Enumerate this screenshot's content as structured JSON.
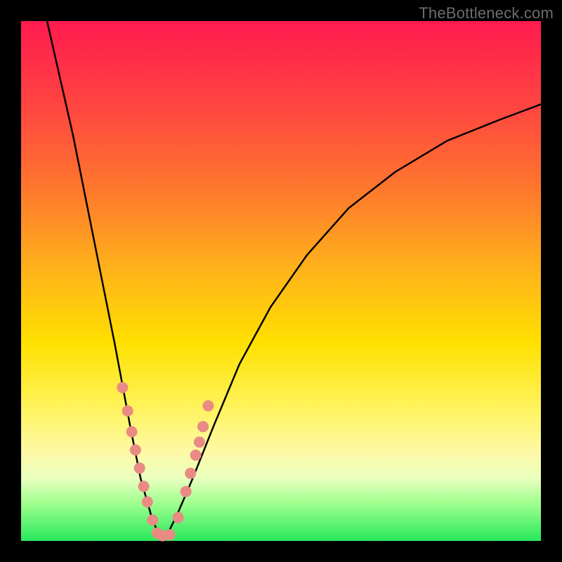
{
  "watermark": "TheBottleneck.com",
  "chart_data": {
    "type": "line",
    "title": "",
    "xlabel": "",
    "ylabel": "",
    "xlim": [
      0,
      100
    ],
    "ylim": [
      0,
      100
    ],
    "grid": false,
    "legend": false,
    "description": "Bottleneck curve on a vertical green-to-red gradient background. Single black V-shaped curve with salmon-colored data points near the minimum. Minimum (~0 bottleneck) occurs around x≈27 on a 0–100 axis.",
    "series": [
      {
        "name": "bottleneck-curve",
        "color": "#000000",
        "x": [
          5,
          10,
          14,
          18,
          21,
          23,
          25,
          26.5,
          28,
          30,
          33,
          37,
          42,
          48,
          55,
          63,
          72,
          82,
          92,
          100
        ],
        "y": [
          100,
          78,
          58,
          38,
          22,
          12,
          5,
          1,
          1,
          5,
          12,
          22,
          34,
          45,
          55,
          64,
          71,
          77,
          81,
          84
        ]
      }
    ],
    "points": {
      "name": "measurements",
      "color": "#e98b84",
      "radius_px": 8,
      "x": [
        19.5,
        20.5,
        21.3,
        22.0,
        22.8,
        23.6,
        24.3,
        25.3,
        26.2,
        27.2,
        28.6,
        30.2,
        31.7,
        32.6,
        33.6,
        34.3,
        35.0,
        36.0
      ],
      "y": [
        29.5,
        25.0,
        21.0,
        17.5,
        14.0,
        10.5,
        7.5,
        4.0,
        1.5,
        1.0,
        1.2,
        4.5,
        9.5,
        13.0,
        16.5,
        19.0,
        22.0,
        26.0
      ]
    }
  }
}
